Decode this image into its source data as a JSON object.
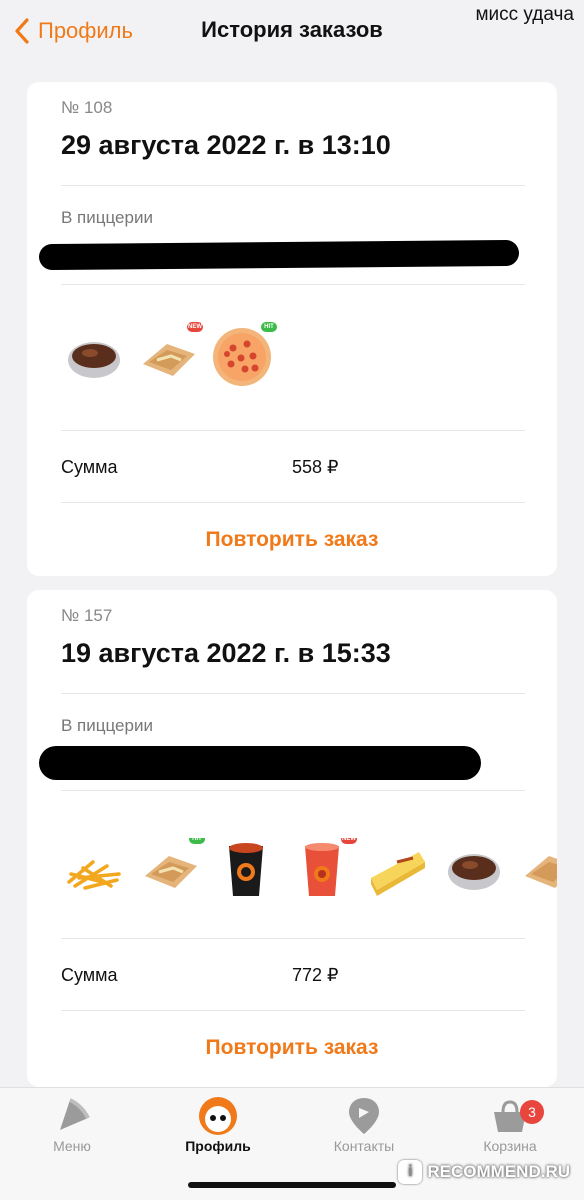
{
  "watermark_top": "мисс удача",
  "header": {
    "back_label": "Профиль",
    "title": "История заказов"
  },
  "orders": [
    {
      "number": "№ 108",
      "date": "29 августа 2022 г. в 13:10",
      "place_label": "В пиццерии",
      "items": [
        "chocolate-fondant",
        "wrap",
        "pepperoni-pizza"
      ],
      "sum_label": "Сумма",
      "sum_value": "558 ₽",
      "repeat_label": "Повторить заказ"
    },
    {
      "number": "№ 157",
      "date": "19 августа 2022 г. в 15:33",
      "place_label": "В пиццерии",
      "items": [
        "fries",
        "wrap",
        "coffee-cup",
        "red-drink",
        "cheesecake",
        "chocolate-fondant",
        "wrap"
      ],
      "sum_label": "Сумма",
      "sum_value": "772 ₽",
      "repeat_label": "Повторить заказ"
    }
  ],
  "tabbar": {
    "tabs": [
      {
        "label": "Меню",
        "icon": "pizza-slice-icon"
      },
      {
        "label": "Профиль",
        "icon": "profile-face-icon",
        "active": true
      },
      {
        "label": "Контакты",
        "icon": "location-pin-icon"
      },
      {
        "label": "Корзина",
        "icon": "basket-icon",
        "badge": "3"
      }
    ]
  },
  "watermark_bottom": "RECOMMEND.RU",
  "colors": {
    "accent": "#f07a1a",
    "badge_red": "#e8453c",
    "new_badge": "#e8453c",
    "hit_badge": "#3cbb4a"
  }
}
